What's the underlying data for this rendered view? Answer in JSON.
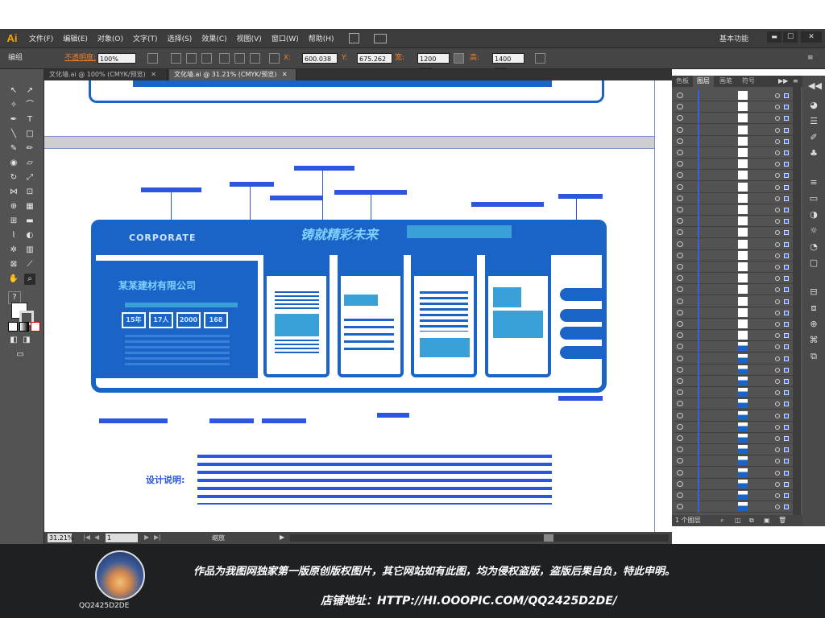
{
  "app": {
    "logo": "Ai",
    "workspace": "基本功能"
  },
  "menu": [
    "文件(F)",
    "编辑(E)",
    "对象(O)",
    "文字(T)",
    "选择(S)",
    "效果(C)",
    "视图(V)",
    "窗口(W)",
    "帮助(H)"
  ],
  "window_controls": {
    "minimize": "▬",
    "maximize": "☐",
    "close": "✕"
  },
  "control_bar": {
    "mode": "编组",
    "opacity_label": "不透明度:",
    "opacity_value": "100%",
    "x_label": "X:",
    "x_value": "600.038",
    "y_label": "Y:",
    "y_value": "675.262",
    "w_label": "宽:",
    "w_value": "1200 mm",
    "h_label": "高:",
    "h_value": "1400 mm"
  },
  "tabs": [
    {
      "label": "文化墙.ai @ 100% (CMYK/预览)",
      "close": "✕"
    },
    {
      "label": "文化墙.ai @ 31.21% (CMYK/预览)",
      "close": "✕"
    }
  ],
  "status": {
    "zoom": "31.21%",
    "page": "1",
    "info": "缩放"
  },
  "right_panel": {
    "tabs": [
      "色板",
      "图层",
      "画笔",
      "符号"
    ],
    "footer_count": "1 个图层"
  },
  "artboard": {
    "header_title": "CORPORATE",
    "banner_slogan": "铸就精彩未来",
    "company_title": "某某建材有限公司",
    "stat_labels": [
      "15年",
      "17人",
      "2000",
      "168"
    ],
    "design_label": "设计说明:"
  },
  "banner": {
    "shop_name": "QQ2425D2DE",
    "notice": "作品为我图网独家第一版原创版权图片，其它网站如有此图，均为侵权盗版，盗版后果自负，特此申明。",
    "address": "店铺地址：HTTP://HI.OOOPIC.COM/QQ2425D2DE/"
  },
  "colors": {
    "accent": "#1a63c7",
    "light_accent": "#3aa0d8",
    "selection": "#2a56e0",
    "ui_dark": "#3c3c3c",
    "ui_mid": "#535353"
  }
}
